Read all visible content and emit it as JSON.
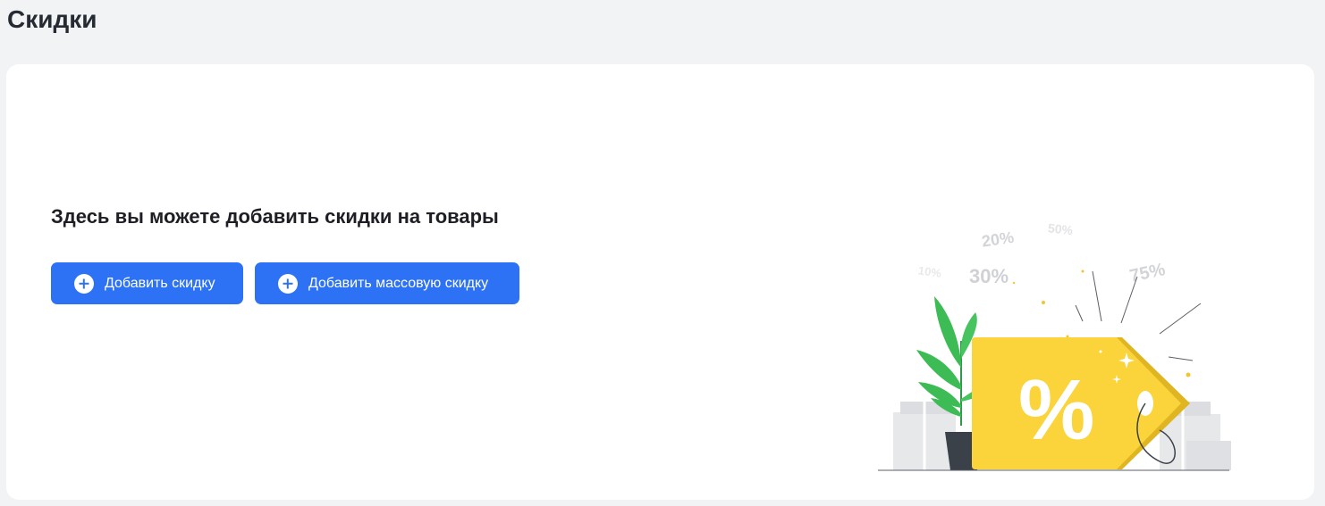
{
  "page": {
    "title": "Скидки"
  },
  "empty_state": {
    "heading": "Здесь вы можете добавить скидки на товары",
    "add_discount_label": "Добавить скидку",
    "add_mass_discount_label": "Добавить массовую скидку"
  },
  "illustration": {
    "percent_symbol": "%",
    "floating_labels": [
      "20%",
      "50%",
      "30%",
      "10%",
      "75%"
    ]
  },
  "colors": {
    "accent": "#2d72f5",
    "tag": "#fbd33a",
    "leaf": "#3dbb55",
    "background": "#f2f3f5"
  }
}
